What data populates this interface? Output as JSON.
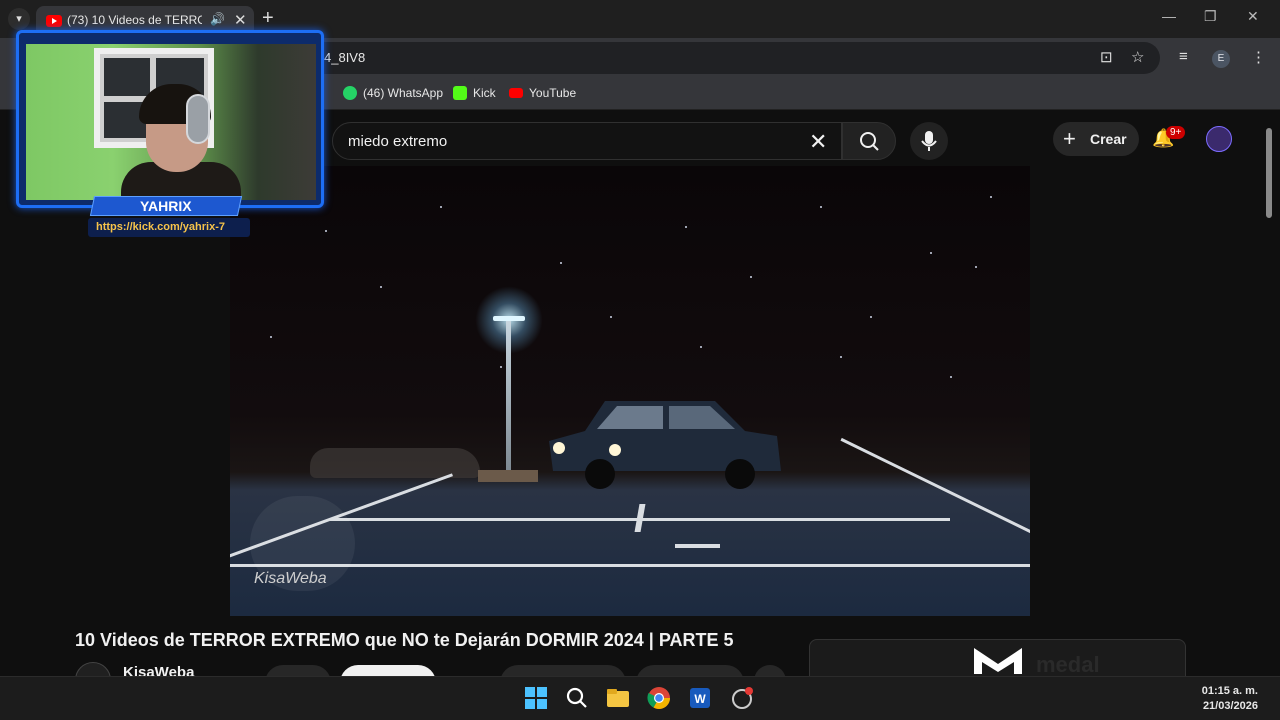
{
  "browser": {
    "tab": {
      "title": "(73) 10 Videos de TERROR E",
      "close": "✕"
    },
    "new_tab": "+",
    "window_controls": [
      "—",
      "❐",
      "✕"
    ],
    "url_fragment": "4_8IV8",
    "profile_initial": "E",
    "bookmarks": [
      {
        "label": "(46) WhatsApp",
        "color": "#25d366"
      },
      {
        "label": "Kick",
        "color": "#53fc18"
      },
      {
        "label": "YouTube",
        "color": "#ff0000"
      }
    ]
  },
  "youtube": {
    "search_query": "miedo extremo",
    "create_label": "Crear",
    "notifications_badge": "9+"
  },
  "video": {
    "title": "10 Videos de TERROR EXTREMO que NO te Dejarán DORMIR 2024 | PARTE 5",
    "channel": "KisaWeba",
    "watermark": "KisaWeba"
  },
  "ad": {
    "brand": "medal"
  },
  "stream_overlay": {
    "streamer_name": "YAHRIX",
    "stream_url": "https://kick.com/yahrix-7"
  },
  "taskbar": {
    "time": "01:15 a. m.",
    "date": "21/03/2026"
  }
}
